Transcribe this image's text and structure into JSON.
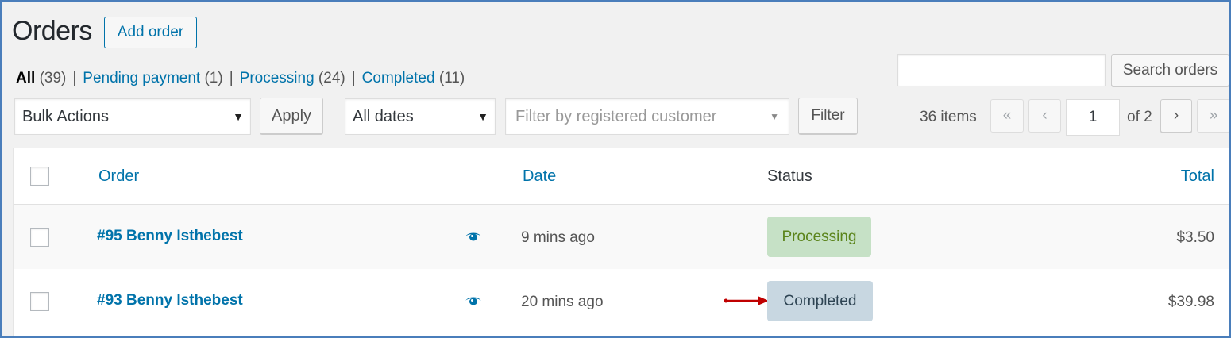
{
  "header": {
    "title": "Orders",
    "add_order_label": "Add order"
  },
  "views": [
    {
      "label": "All",
      "count": "(39)"
    },
    {
      "label": "Pending payment",
      "count": "(1)"
    },
    {
      "label": "Processing",
      "count": "(24)"
    },
    {
      "label": "Completed",
      "count": "(11)"
    }
  ],
  "separator": "|",
  "search": {
    "value": "",
    "button_label": "Search orders"
  },
  "toolbar": {
    "bulk_actions": "Bulk Actions",
    "apply_label": "Apply",
    "dates": "All dates",
    "customer_placeholder": "Filter by registered customer",
    "filter_label": "Filter",
    "caret": "▼",
    "caret_small": "▼"
  },
  "pagination": {
    "items": "36 items",
    "first": "«",
    "prev": "‹",
    "current_page": "1",
    "of_pages": "of 2",
    "next": "›",
    "last": "»"
  },
  "table": {
    "columns": {
      "order": "Order",
      "date": "Date",
      "status": "Status",
      "total": "Total"
    },
    "rows": [
      {
        "order": "#95 Benny Isthebest",
        "date": "9 mins ago",
        "status": "Processing",
        "total": "$3.50"
      },
      {
        "order": "#93 Benny Isthebest",
        "date": "20 mins ago",
        "status": "Completed",
        "total": "$39.98"
      }
    ]
  },
  "colors": {
    "link": "#0073aa",
    "frame_border": "#4a7ebb",
    "processing_bg": "#c6e1c6",
    "processing_text": "#5b841b",
    "completed_bg": "#c8d7e1",
    "completed_text": "#2e4453",
    "annotation_arrow": "#c00000"
  },
  "icons": {
    "preview": "eye-icon",
    "annotation": "red-arrow-annotation"
  }
}
